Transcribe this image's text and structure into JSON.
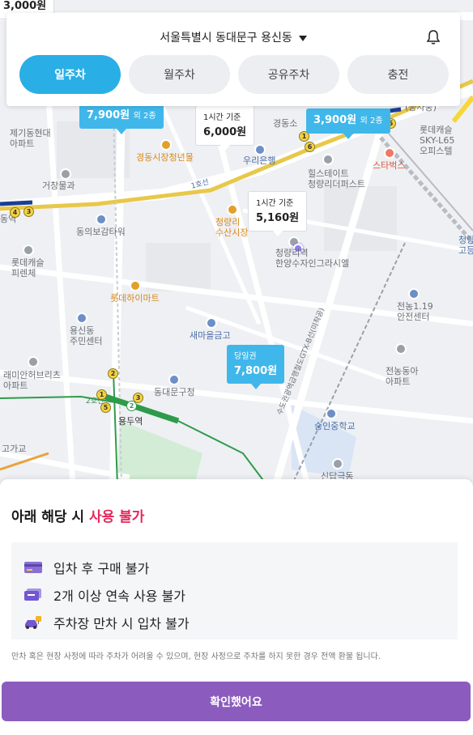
{
  "header": {
    "location": "서울특별시 동대문구 용신동",
    "tabs": [
      {
        "label": "일주차",
        "active": true
      },
      {
        "label": "월주차",
        "active": false
      },
      {
        "label": "공유주차",
        "active": false
      },
      {
        "label": "충전",
        "active": false
      }
    ]
  },
  "map": {
    "price_tags": [
      {
        "top": "",
        "price": "3,000원",
        "extra": ""
      },
      {
        "top": "",
        "price": "7,900원",
        "extra": "외 2종"
      },
      {
        "top": "1시간 기준",
        "price": "6,000원",
        "extra": ""
      },
      {
        "top": "",
        "price": "3,900원",
        "extra": "외 2종"
      },
      {
        "top": "1시간 기준",
        "price": "5,160원",
        "extra": ""
      },
      {
        "top": "당일권",
        "price": "7,800원",
        "extra": ""
      }
    ],
    "places": {
      "p1": "제기동현대",
      "p1b": "아파트",
      "p2": "거창빌",
      "p3": "거창물과",
      "p4": "동의보감타워",
      "p5": "롯데캐슬",
      "p5b": "피렌체",
      "p6": "용신동",
      "p6b": "주민센터",
      "p7": "래미안허브리츠",
      "p7b": "아파트",
      "p8": "고가교",
      "p9": "경동시장청년몰",
      "p10": "청량리",
      "p10b": "수산시장",
      "p11": "롯데하이마트",
      "p12": "새마을금고",
      "p13": "동대문구청",
      "p14": "용두역",
      "p15": "경동소",
      "p16": "우리은행",
      "p17": "힐스테이트",
      "p17b": "청량리더퍼스트",
      "p18": "청량리역",
      "p18b": "한양수자인그라시엘",
      "p19": "스타벅스",
      "p20": "롯데캐슬",
      "p20b": "SKY-L65",
      "p20c": "오피스텔",
      "p21": "전농1.19",
      "p21b": "안전센터",
      "p22": "전농동아",
      "p22b": "아파트",
      "p23": "숭인중학교",
      "p24": "신답극동",
      "p25": "청량",
      "p25b": "고등",
      "p26": "(공사중)",
      "p27": "동역",
      "p28": "1호선",
      "p29": "2호선",
      "p30": "수도권광역급행철도GTX-B선(미착공)"
    }
  },
  "sheet": {
    "title_prefix": "아래 해당 시 ",
    "title_highlight": "사용 불가",
    "rules": [
      "입차 후 구매 불가",
      "2개 이상 연속 사용 불가",
      "주차장 만차 시 입차 불가"
    ],
    "note": "만차 혹은 현장 사정에 따라 주차가 어려울 수 있으며, 현장 사정으로 주차를 하지 못한 경우 전액 환불 됩니다.",
    "confirm_label": "확인했어요"
  },
  "colors": {
    "accent": "#29aee6",
    "confirm": "#8b5cbd",
    "warning": "#e6275a",
    "tag": "#40b7ea"
  }
}
